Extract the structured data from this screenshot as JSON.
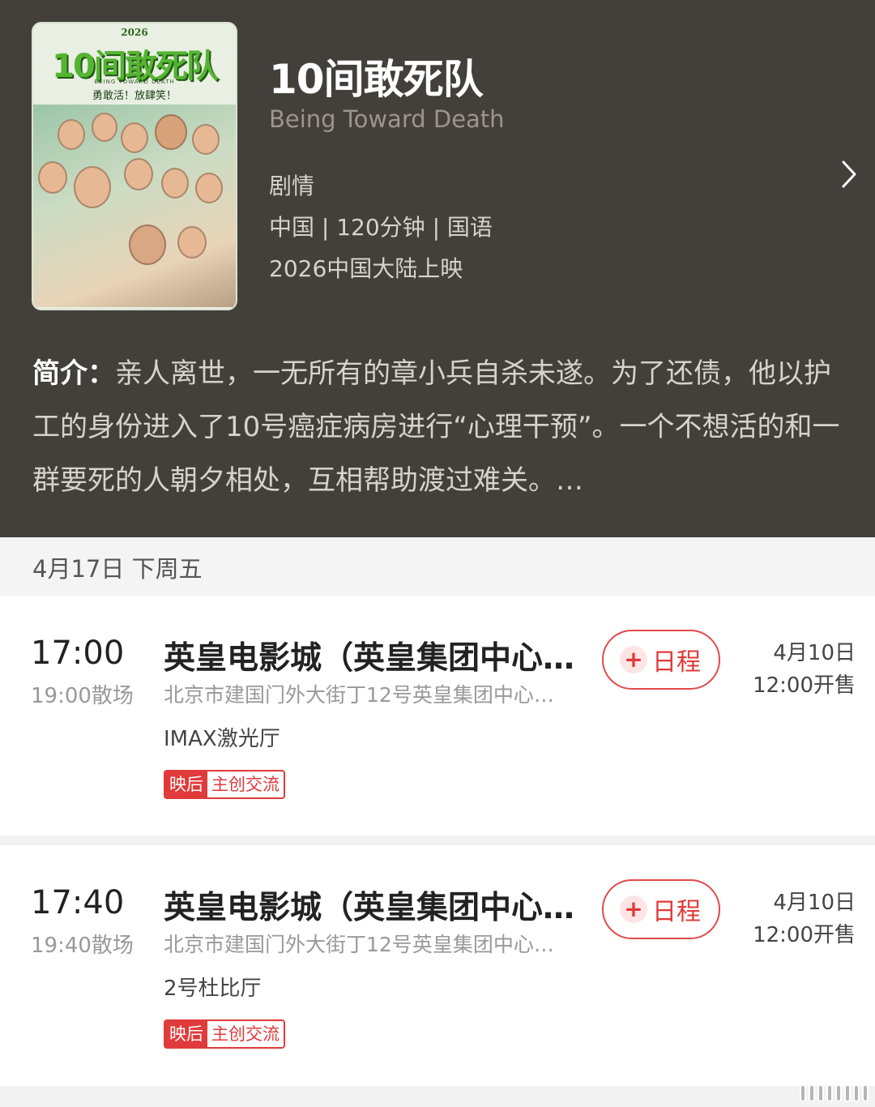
{
  "movie": {
    "title": "10间敢死队",
    "en_title": "Being Toward Death",
    "genre": "剧情",
    "info": "中国 | 120分钟 | 国语",
    "release": "2026中国大陆上映",
    "poster": {
      "year": "2026",
      "title": "10间敢死队",
      "subtitle": "BEING TOWARD DEATH",
      "slogan": "勇敢活！放肆笑！"
    },
    "intro_label": "简介：",
    "intro_text": "亲人离世，一无所有的章小兵自杀未遂。为了还债，他以护工的身份进入了10号癌症病房进行“心理干预”。一个不想活的和一群要死的人朝夕相处，互相帮助渡过难关。…"
  },
  "date_bar": "4月17日  下周五",
  "shows": [
    {
      "time": "17:00",
      "end": "19:00散场",
      "cinema": "英皇电影城（英皇集团中心店）",
      "address": "北京市建国门外大街丁12号英皇集团中心…",
      "hall": "IMAX激光厅",
      "tag_a": "映后",
      "tag_b": "主创交流",
      "button_plus": "+",
      "button": "日程",
      "sale_date": "4月10日",
      "sale_time": "12:00开售"
    },
    {
      "time": "17:40",
      "end": "19:40散场",
      "cinema": "英皇电影城（英皇集团中心店）",
      "address": "北京市建国门外大街丁12号英皇集团中心…",
      "hall": "2号杜比厅",
      "tag_a": "映后",
      "tag_b": "主创交流",
      "button_plus": "+",
      "button": "日程",
      "sale_date": "4月10日",
      "sale_time": "12:00开售"
    }
  ],
  "colors": {
    "header_bg": "#433f3a",
    "accent_red": "#e03a3a"
  },
  "icons": [
    "chevron-right-icon",
    "plus-icon",
    "watermark-icon"
  ]
}
